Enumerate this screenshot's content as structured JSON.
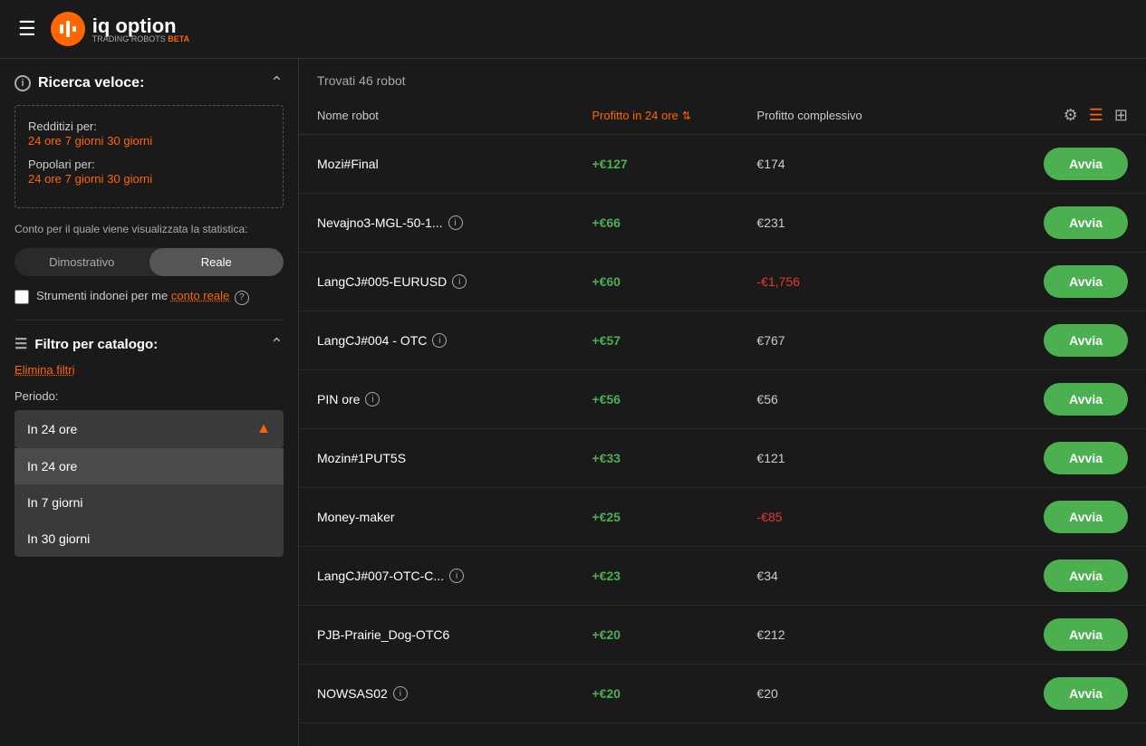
{
  "header": {
    "hamburger_label": "☰",
    "logo_text": "iq option",
    "logo_sub": "TRADING ROBOTS",
    "beta": "BETA"
  },
  "sidebar": {
    "quick_search_title": "Ricerca veloce:",
    "profitable_label": "Redditizi per:",
    "profitable_links": [
      "24 ore",
      "7 giorni",
      "30 giorni"
    ],
    "popular_label": "Popolari per:",
    "popular_links": [
      "24 ore",
      "7 giorni",
      "30 giorni"
    ],
    "stat_label": "Conto per il quale viene visualizzata la statistica:",
    "toggle_demo": "Dimostrativo",
    "toggle_real": "Reale",
    "checkbox_label": "Strumenti indonei per me",
    "real_account_link": "conto reale",
    "filter_title": "Filtro per catalogo:",
    "clear_filters": "Elimina filtri",
    "period_label": "Periodo:",
    "dropdown_selected": "In 24 ore",
    "dropdown_options": [
      "In 24 ore",
      "In 7 giorni",
      "In 30 giorni"
    ]
  },
  "content": {
    "results_count": "Trovati 46 robot",
    "col_name": "Nome robot",
    "col_profit24": "Profitto in 24 ore",
    "col_profit_total": "Profitto complessivo",
    "robots": [
      {
        "name": "Mozi#Final",
        "has_info": false,
        "profit24": "+€127",
        "profit_total": "€174",
        "total_positive": true
      },
      {
        "name": "Nevajno3-MGL-50-1...",
        "has_info": true,
        "profit24": "+€66",
        "profit_total": "€231",
        "total_positive": true
      },
      {
        "name": "LangCJ#005-EURUSD",
        "has_info": true,
        "profit24": "+€60",
        "profit_total": "-€1,756",
        "total_positive": false
      },
      {
        "name": "LangCJ#004 - OTC",
        "has_info": true,
        "profit24": "+€57",
        "profit_total": "€767",
        "total_positive": true
      },
      {
        "name": "PIN ore",
        "has_info": true,
        "profit24": "+€56",
        "profit_total": "€56",
        "total_positive": true
      },
      {
        "name": "Mozin#1PUT5S",
        "has_info": false,
        "profit24": "+€33",
        "profit_total": "€121",
        "total_positive": true
      },
      {
        "name": "Money-maker",
        "has_info": false,
        "profit24": "+€25",
        "profit_total": "-€85",
        "total_positive": false
      },
      {
        "name": "LangCJ#007-OTC-C...",
        "has_info": true,
        "profit24": "+€23",
        "profit_total": "€34",
        "total_positive": true
      },
      {
        "name": "PJB-Prairie_Dog-OTC6",
        "has_info": false,
        "profit24": "+€20",
        "profit_total": "€212",
        "total_positive": true
      },
      {
        "name": "NOWSAS02",
        "has_info": true,
        "profit24": "+€20",
        "profit_total": "€20",
        "total_positive": true
      }
    ],
    "avvia_label": "Avvia"
  }
}
